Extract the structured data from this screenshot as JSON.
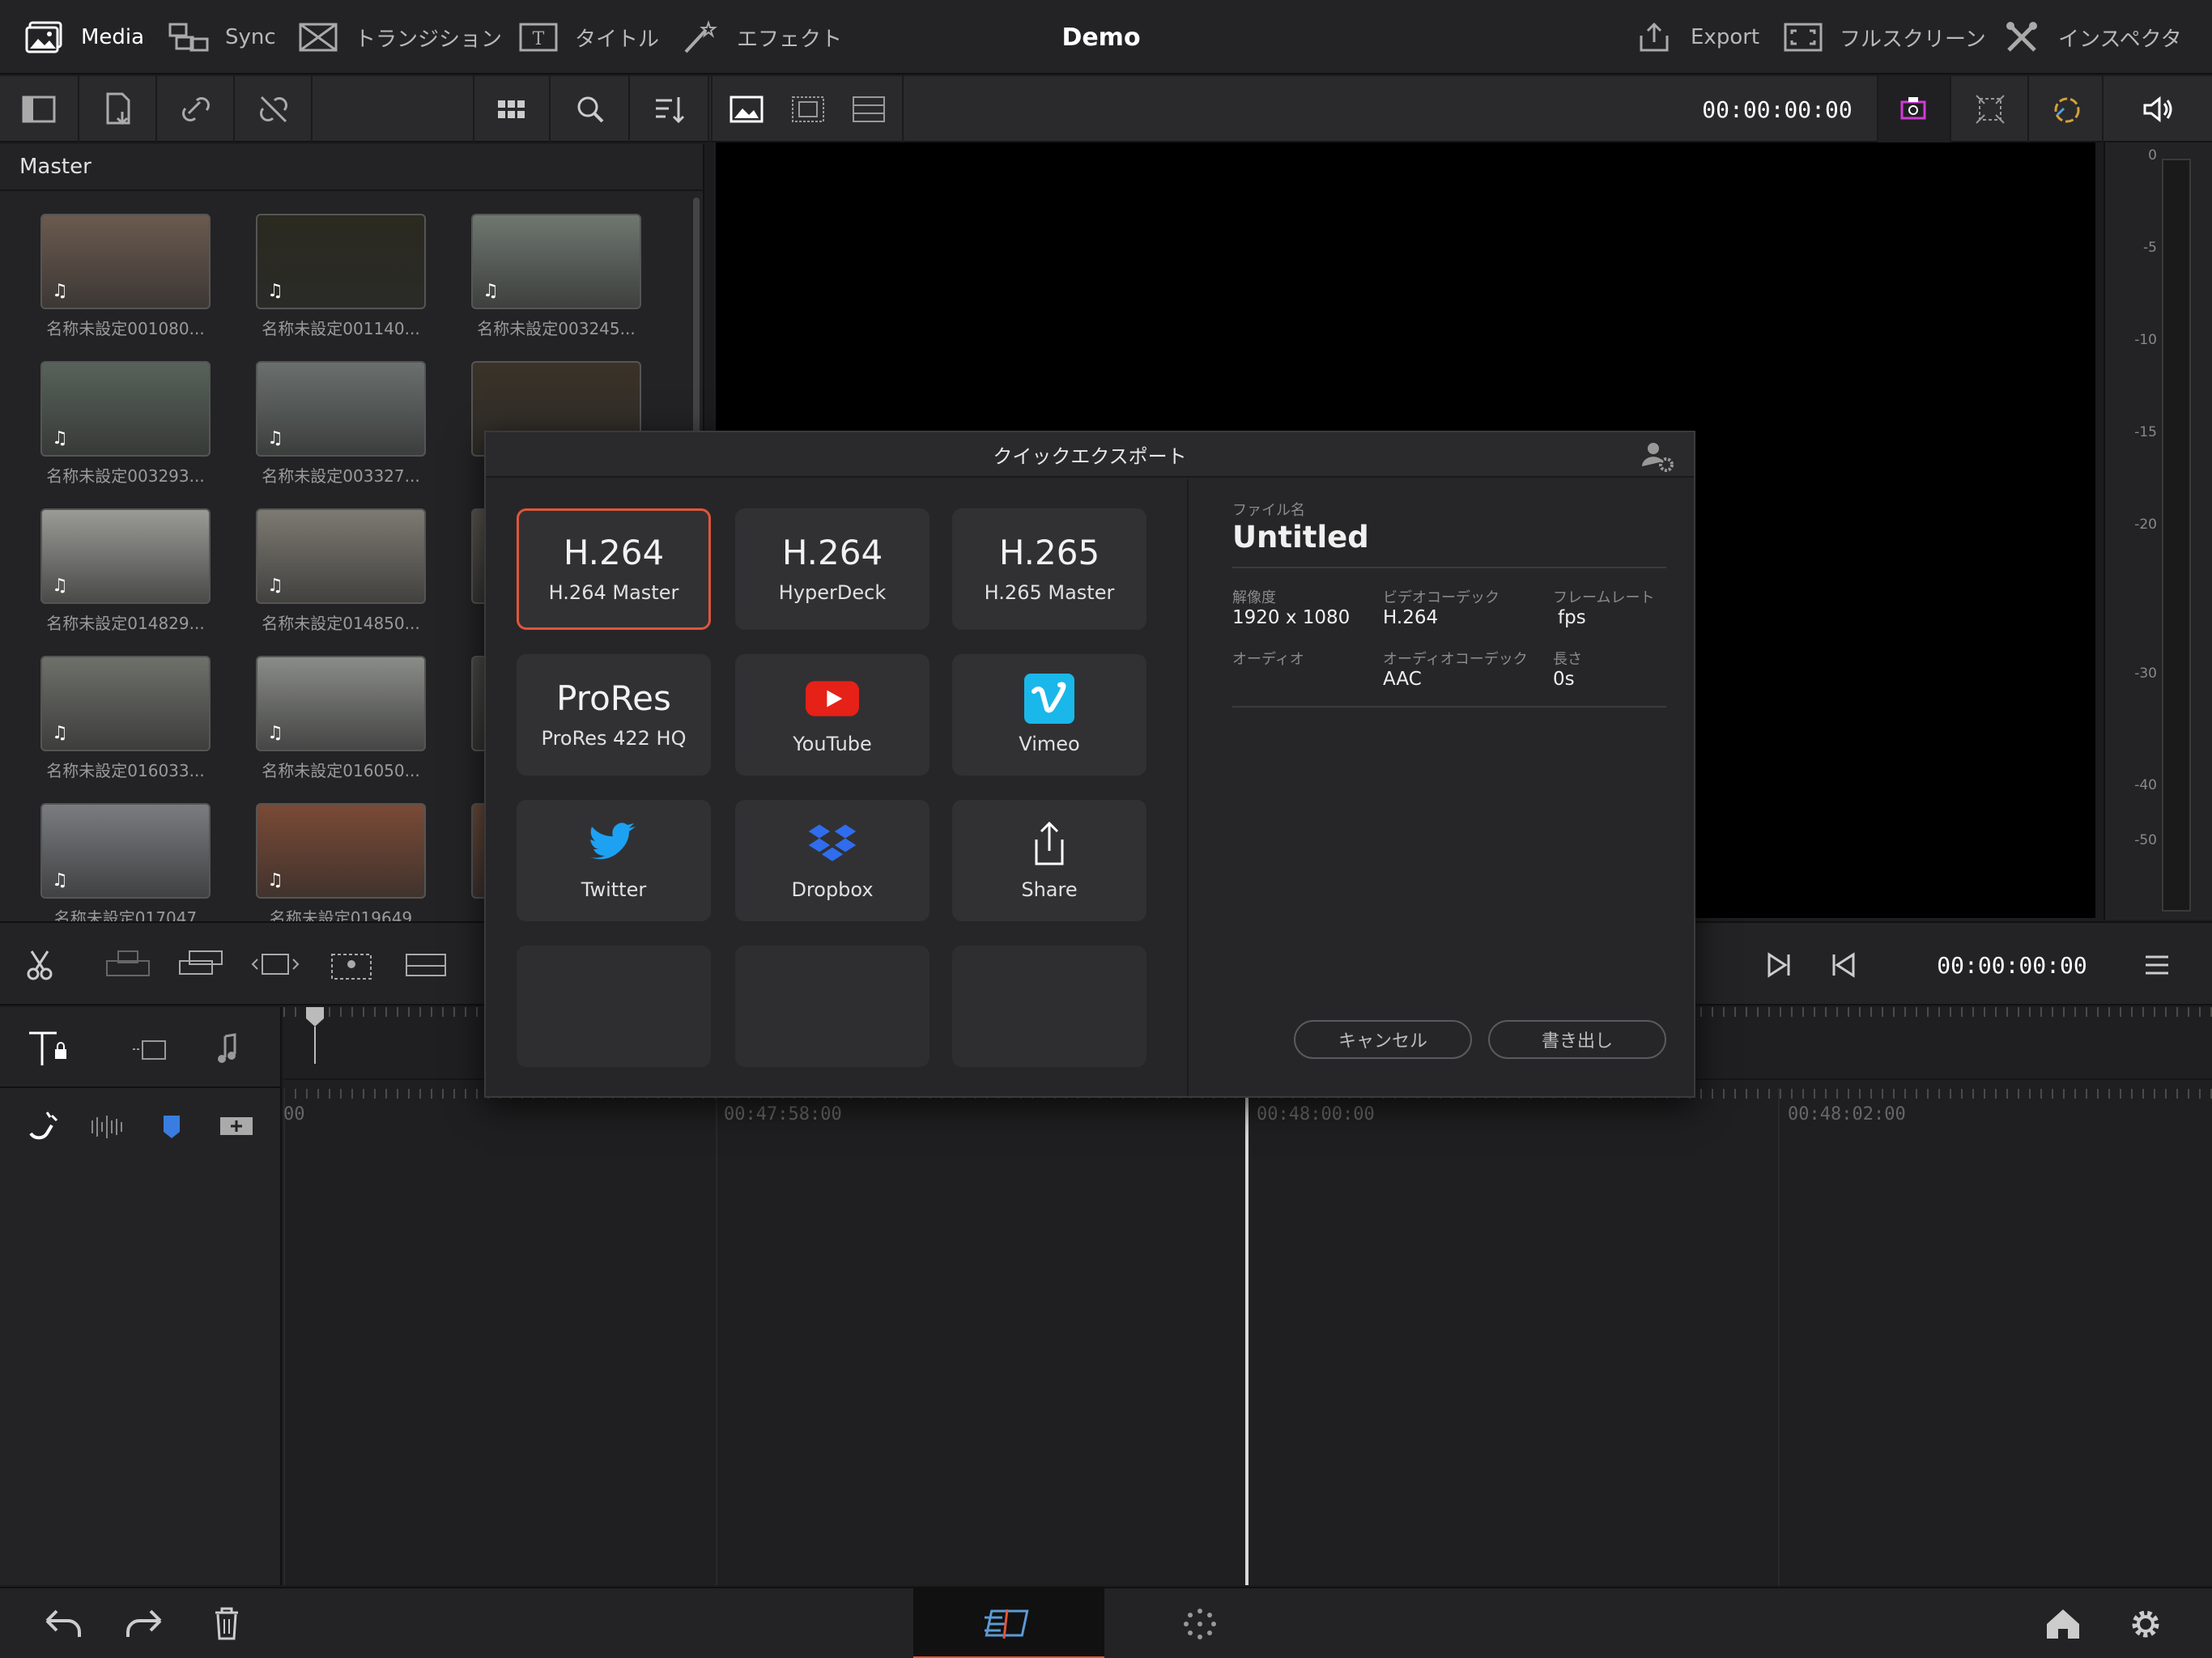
{
  "menu": {
    "media": "Media",
    "sync": "Sync",
    "transition": "トランジション",
    "title": "タイトル",
    "effect": "エフェクト",
    "app_title": "Demo",
    "export": "Export",
    "fullscreen": "フルスクリーン",
    "inspector": "インスペクタ"
  },
  "toolbar": {
    "timecode": "00:00:00:00"
  },
  "media_pool": {
    "header": "Master",
    "clips": [
      {
        "label": "名称未設定001080...",
        "tone": "#6b5a4f"
      },
      {
        "label": "名称未設定001140...",
        "tone": "#2b2a20"
      },
      {
        "label": "名称未設定003245...",
        "tone": "#6f7770"
      },
      {
        "label": "名称未設定003293...",
        "tone": "#58625a"
      },
      {
        "label": "名称未設定003327...",
        "tone": "#6a706e"
      },
      {
        "label": "名",
        "tone": "#3a3228"
      },
      {
        "label": "名称未設定014829...",
        "tone": "#9a9a96"
      },
      {
        "label": "名称未設定014850...",
        "tone": "#7d7a72"
      },
      {
        "label": "名",
        "tone": "#5a5650"
      },
      {
        "label": "名称未設定016033...",
        "tone": "#6e706a"
      },
      {
        "label": "名称未設定016050...",
        "tone": "#8a8c88"
      },
      {
        "label": "名",
        "tone": "#4a4a46"
      },
      {
        "label": "名称未設定017047",
        "tone": "#7a7c80"
      },
      {
        "label": "名称未設定019649",
        "tone": "#7a4a36"
      },
      {
        "label": "",
        "tone": "#6a4a3a"
      }
    ]
  },
  "meter": {
    "ticks": [
      "0",
      "-5",
      "-10",
      "-15",
      "-20",
      "-30",
      "-40",
      "-50"
    ]
  },
  "edit_bar": {
    "timecode": "00:00:00:00"
  },
  "timeline": {
    "labels": [
      "00",
      "00:47:58:00",
      "00:48:00:00",
      "00:48:02:00"
    ]
  },
  "dialog": {
    "title": "クイックエクスポート",
    "presets": [
      {
        "big": "H.264",
        "small": "H.264 Master",
        "selected": true
      },
      {
        "big": "H.264",
        "small": "HyperDeck"
      },
      {
        "big": "H.265",
        "small": "H.265 Master"
      },
      {
        "big": "ProRes",
        "small": "ProRes 422 HQ"
      },
      {
        "logo": "youtube-icon",
        "small": "YouTube"
      },
      {
        "logo": "vimeo-icon",
        "small": "Vimeo"
      },
      {
        "logo": "twitter-icon",
        "small": "Twitter"
      },
      {
        "logo": "dropbox-icon",
        "small": "Dropbox"
      },
      {
        "logo": "share-icon",
        "small": "Share"
      }
    ],
    "filename_label": "ファイル名",
    "filename": "Untitled",
    "resolution_label": "解像度",
    "resolution": "1920 x 1080",
    "video_codec_label": "ビデオコーデック",
    "video_codec": "H.264",
    "frame_rate_label": "フレームレート",
    "frame_rate": "fps",
    "audio_label": "オーディオ",
    "audio_codec_label": "オーディオコーデック",
    "audio_codec": "AAC",
    "duration_label": "長さ",
    "duration": "0s",
    "cancel": "キャンセル",
    "export": "書き出し"
  },
  "colors": {
    "accent": "#e0553c",
    "youtube": "#e62117",
    "vimeo": "#1ab7ea",
    "twitter": "#1da1f2",
    "dropbox": "#2f6dee"
  }
}
